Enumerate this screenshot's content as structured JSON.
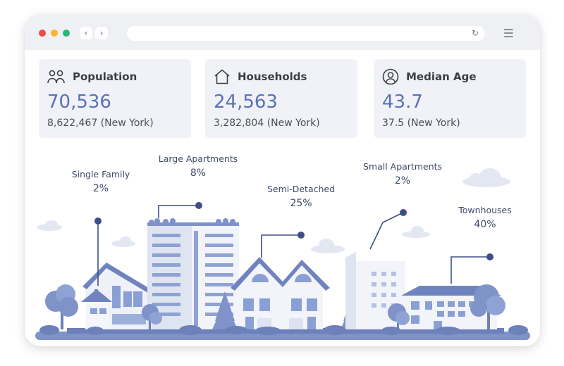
{
  "browser": {
    "controls": {
      "back": "‹",
      "forward": "›",
      "reload": "↻"
    },
    "colors": {
      "close": "#ee4b4b",
      "minimize": "#f7b731",
      "maximize": "#2bb673"
    }
  },
  "stats": [
    {
      "title": "Population",
      "value": "70,536",
      "sub": "8,622,467 (New York)",
      "icon": "people-icon"
    },
    {
      "title": "Households",
      "value": "24,563",
      "sub": "3,282,804 (New York)",
      "icon": "house-icon"
    },
    {
      "title": "Median Age",
      "value": "43.7",
      "sub": "37.5 (New York)",
      "icon": "user-circle-icon"
    }
  ],
  "housing": [
    {
      "name": "Single Family",
      "pct": "2%"
    },
    {
      "name": "Large Apartments",
      "pct": "8%"
    },
    {
      "name": "Semi-Detached",
      "pct": "25%"
    },
    {
      "name": "Small Apartments",
      "pct": "2%"
    },
    {
      "name": "Townhouses",
      "pct": "40%"
    }
  ],
  "colors": {
    "accent": "#5a72b5",
    "card": "#f0f2f7",
    "illustration": "#7f93c9",
    "dark": "#4f62a0"
  }
}
